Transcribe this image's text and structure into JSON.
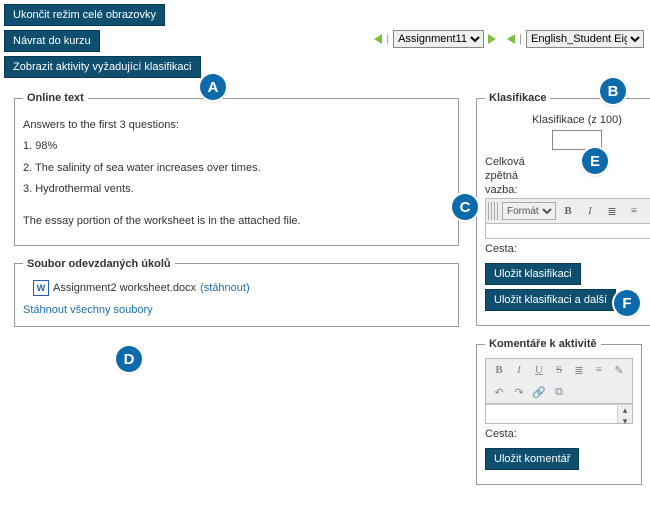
{
  "top_buttons": {
    "exit_fullscreen": "Ukončit režim celé obrazovky",
    "back_to_course": "Návrat do kurzu",
    "show_grading_activities": "Zobrazit aktivity vyžadující klasifikaci"
  },
  "nav": {
    "assignment_selected": "Assignment11",
    "student_selected": "English_Student Eight"
  },
  "online_text": {
    "legend": "Online text",
    "intro": "Answers to the first 3 questions:",
    "a1": "1. 98%",
    "a2": "2. The salinity of sea water increases over times.",
    "a3": "3. Hydrothermal vents.",
    "note": "The essay portion of the worksheet is in the attached file."
  },
  "files": {
    "legend": "Soubor odevzdaných úkolů",
    "file1_name": "Assignment2 worksheet.docx",
    "file1_action": "(stáhnout)",
    "download_all": "Stáhnout všechny soubory"
  },
  "grading": {
    "legend": "Klasifikace",
    "out_of_label": "Klasifikace (z 100)",
    "feedback_label_l1": "Celková",
    "feedback_label_l2": "zpětná",
    "feedback_label_l3": "vazba:",
    "format_label": "Formát",
    "path_label": "Cesta:",
    "save_btn": "Uložit klasifikaci",
    "save_next_btn": "Uložit klasifikaci a další"
  },
  "comments": {
    "legend": "Komentáře k aktivitě",
    "path_label": "Cesta:",
    "save_btn": "Uložit komentář"
  },
  "markers": {
    "A": "A",
    "B": "B",
    "C": "C",
    "D": "D",
    "E": "E",
    "F": "F"
  }
}
